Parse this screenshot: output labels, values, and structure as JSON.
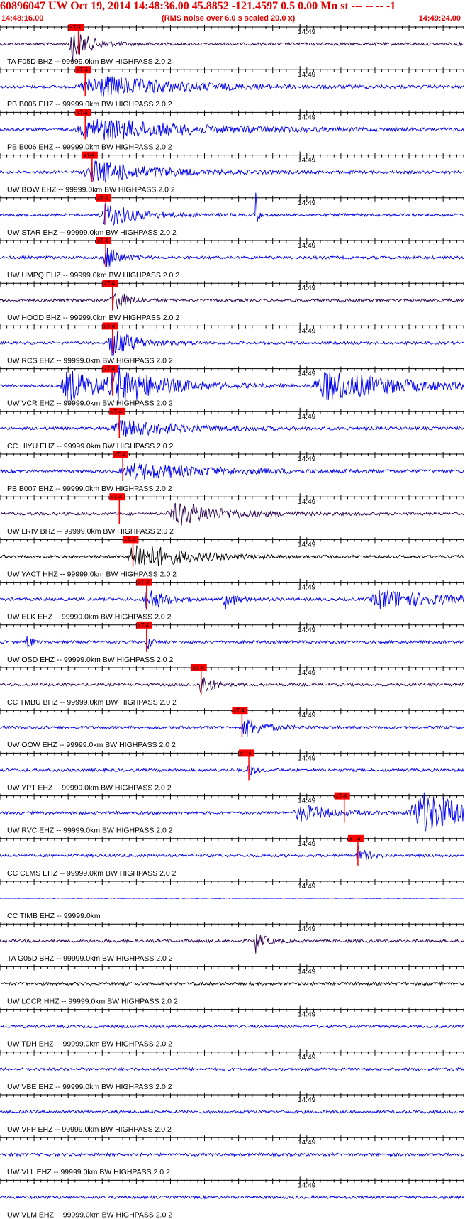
{
  "header": {
    "title": "60896047 UW Oct 19, 2014 14:48:36.00   45.8852 -121.4597  0.5 0.00 Mn st --- -- --  -1",
    "start_time": "14:48:16.00",
    "note": "(RMS noise over 6.0 s scaled 20.0 x)",
    "end_time": "14:49:24.00"
  },
  "colors": {
    "axis": "#000000",
    "pick": "#ff0000",
    "trace_blue": "#0000ee",
    "trace_purple": "#2a0050",
    "trace_black": "#000000",
    "header": "#e00000"
  },
  "chart_data": {
    "type": "line",
    "x_range_seconds": [
      0,
      68
    ],
    "minute_tick_label": "14:49",
    "pick_label": "xT-4",
    "traces": [
      {
        "label": "TA F05D BHZ -- 99999.0km BW  HIGHPASS  2.0  2",
        "color": "purple",
        "pick_s": 11.5,
        "bursts": [
          [
            10.5,
            3.0,
            3.0
          ]
        ]
      },
      {
        "label": "PB B005 EHZ -- 99999.0km BW  HIGHPASS  2.0  2",
        "color": "blue",
        "pick_s": 12.5,
        "bursts": [
          [
            14,
            14,
            2.0
          ]
        ]
      },
      {
        "label": "PB B006 EHZ -- 99999.0km BW  HIGHPASS  2.0  2",
        "color": "blue",
        "pick_s": 12.5,
        "bursts": [
          [
            14,
            16,
            2.0
          ]
        ]
      },
      {
        "label": "UW BOW EHZ -- 99999.0km BW  HIGHPASS  2.0  2",
        "color": "blue",
        "pick_s": 13.5,
        "bursts": [
          [
            14,
            10,
            2.0
          ]
        ]
      },
      {
        "label": "UW STAR EHZ -- 99999.0km BW  HIGHPASS  2.0  2",
        "color": "blue",
        "pick_s": 15.5,
        "bursts": [
          [
            15.5,
            5,
            2.2
          ],
          [
            37.5,
            0.3,
            4.0
          ]
        ]
      },
      {
        "label": "UW UMPQ EHZ -- 99999.0km BW  HIGHPASS  2.0  2",
        "color": "blue",
        "pick_s": 15.5,
        "bursts": [
          [
            15.5,
            2,
            2.5
          ]
        ]
      },
      {
        "label": "UW HOOD BHZ -- 99999.0km BW  HIGHPASS  2.0  2",
        "color": "purple",
        "pick_s": 16.5,
        "bursts": [
          [
            16.5,
            2,
            2.5
          ]
        ]
      },
      {
        "label": "UW RCS EHZ -- 99999.0km BW  HIGHPASS  2.0  2",
        "color": "blue",
        "pick_s": 16.5,
        "bursts": [
          [
            16.5,
            4,
            2.5
          ]
        ]
      },
      {
        "label": "UW VCR EHZ -- 99999.0km BW  HIGHPASS  2.0  2",
        "color": "blue",
        "pick_s": 16.5,
        "bursts": [
          [
            10,
            6,
            3.0
          ],
          [
            17,
            8,
            3.0
          ],
          [
            48,
            12,
            2.8
          ]
        ]
      },
      {
        "label": "CC HIYU EHZ -- 99999.0km BW  HIGHPASS  2.0  2",
        "color": "blue",
        "pick_s": 17.5,
        "bursts": [
          [
            18,
            10,
            1.5
          ]
        ]
      },
      {
        "label": "PB B007 EHZ -- 99999.0km BW  HIGHPASS  2.0  2",
        "color": "blue",
        "pick_s": 18.0,
        "bursts": [
          [
            20,
            14,
            1.4
          ]
        ]
      },
      {
        "label": "UW LRIV BHZ -- 99999.0km BW  HIGHPASS  2.0  2",
        "color": "purple",
        "pick_s": 17.5,
        "bursts": [
          [
            26,
            8,
            2.0
          ]
        ]
      },
      {
        "label": "UW YACT HHZ -- 99999.0km BW  HIGHPASS  2.0  2",
        "color": "black",
        "pick_s": 19.5,
        "bursts": [
          [
            20,
            8,
            2.5
          ]
        ]
      },
      {
        "label": "UW ELK EHZ -- 99999.0km BW  HIGHPASS  2.0  2",
        "color": "blue",
        "pick_s": 21.5,
        "bursts": [
          [
            21.5,
            3,
            2.2
          ],
          [
            33,
            2,
            1.5
          ],
          [
            56,
            10,
            1.8
          ]
        ]
      },
      {
        "label": "UW OSD EHZ -- 99999.0km BW  HIGHPASS  2.0  2",
        "color": "blue",
        "pick_s": 21.5,
        "bursts": [
          [
            4,
            0.6,
            2.0
          ],
          [
            21.5,
            0.8,
            1.4
          ]
        ]
      },
      {
        "label": "CC TMBU BHZ -- 99999.0km BW  HIGHPASS  2.0  2",
        "color": "purple",
        "pick_s": 29.5,
        "bursts": [
          [
            29.5,
            1.5,
            2.5
          ]
        ]
      },
      {
        "label": "UW OOW EHZ -- 99999.0km BW  HIGHPASS  2.0  2",
        "color": "blue",
        "pick_s": 35.5,
        "bursts": [
          [
            36,
            3,
            1.8
          ]
        ]
      },
      {
        "label": "UW YPT EHZ -- 99999.0km BW  HIGHPASS  2.0  2",
        "color": "blue",
        "pick_s": 36.5,
        "bursts": [
          [
            36.5,
            1,
            1.5
          ]
        ]
      },
      {
        "label": "UW RVC EHZ -- 99999.0km BW  HIGHPASS  2.0  2",
        "color": "blue",
        "pick_s": 50.5,
        "bursts": [
          [
            62,
            12,
            3.5
          ],
          [
            44,
            5,
            1.5
          ]
        ]
      },
      {
        "label": "CC CLMS EHZ -- 99999.0km BW  HIGHPASS  2.0  2",
        "color": "blue",
        "pick_s": 52.5,
        "bursts": [
          [
            52.5,
            1.5,
            1.6
          ]
        ]
      },
      {
        "label": "CC TIMB EHZ -- 99999.0km",
        "color": "blue",
        "pick_s": null,
        "bursts": [],
        "flat": true
      },
      {
        "label": "TA G05D BHZ -- 99999.0km BW  HIGHPASS  2.0  2",
        "color": "purple",
        "pick_s": null,
        "bursts": [
          [
            37.5,
            1.5,
            2.0
          ]
        ]
      },
      {
        "label": "UW LCCR HHZ -- 99999.0km BW  HIGHPASS  2.0  2",
        "color": "black",
        "pick_s": null,
        "bursts": []
      },
      {
        "label": "UW TDH EHZ -- 99999.0km BW  HIGHPASS  2.0  2",
        "color": "blue",
        "pick_s": null,
        "bursts": []
      },
      {
        "label": "UW VBE EHZ -- 99999.0km BW  HIGHPASS  2.0  2",
        "color": "blue",
        "pick_s": null,
        "bursts": []
      },
      {
        "label": "UW VFP EHZ -- 99999.0km BW  HIGHPASS  2.0  2",
        "color": "blue",
        "pick_s": null,
        "bursts": []
      },
      {
        "label": "UW VLL EHZ -- 99999.0km BW  HIGHPASS  2.0  2",
        "color": "blue",
        "pick_s": null,
        "bursts": []
      },
      {
        "label": "UW VLM EHZ -- 99999.0km BW  HIGHPASS  2.0  2",
        "color": "blue",
        "pick_s": null,
        "bursts": []
      }
    ]
  }
}
